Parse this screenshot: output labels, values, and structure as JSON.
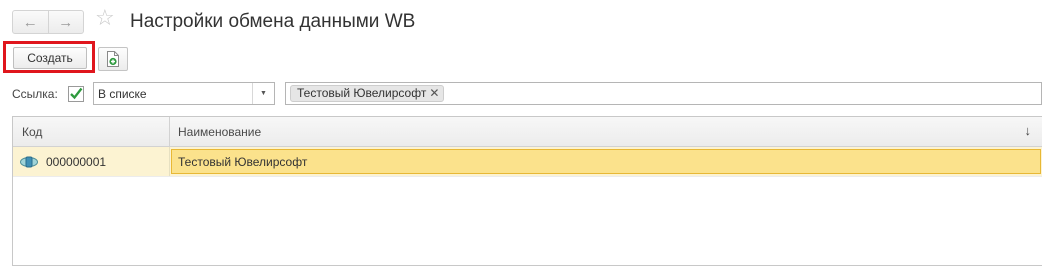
{
  "header": {
    "back_icon": "arrow-left-icon",
    "forward_icon": "arrow-right-icon",
    "favorite_icon": "star-icon",
    "title": "Настройки обмена данными WB"
  },
  "toolbar": {
    "create_label": "Создать",
    "copy_icon": "add-document-icon",
    "highlight_color": "#e0161d"
  },
  "filter": {
    "label": "Ссылка:",
    "checked": true,
    "comparison": "В списке",
    "values": [
      "Тестовый Ювелирсофт"
    ]
  },
  "table": {
    "columns": [
      "Код",
      "Наименование"
    ],
    "sort_icon": "sort-down-arrow-icon",
    "rows": [
      {
        "icon": "exchange-node-icon",
        "code": "000000001",
        "name": "Тестовый Ювелирсофт",
        "selected": true
      }
    ]
  },
  "colors": {
    "selected_row": "#fcf3d2",
    "selected_cell": "#fbe28c",
    "checkbox": "#2e9a3e"
  }
}
